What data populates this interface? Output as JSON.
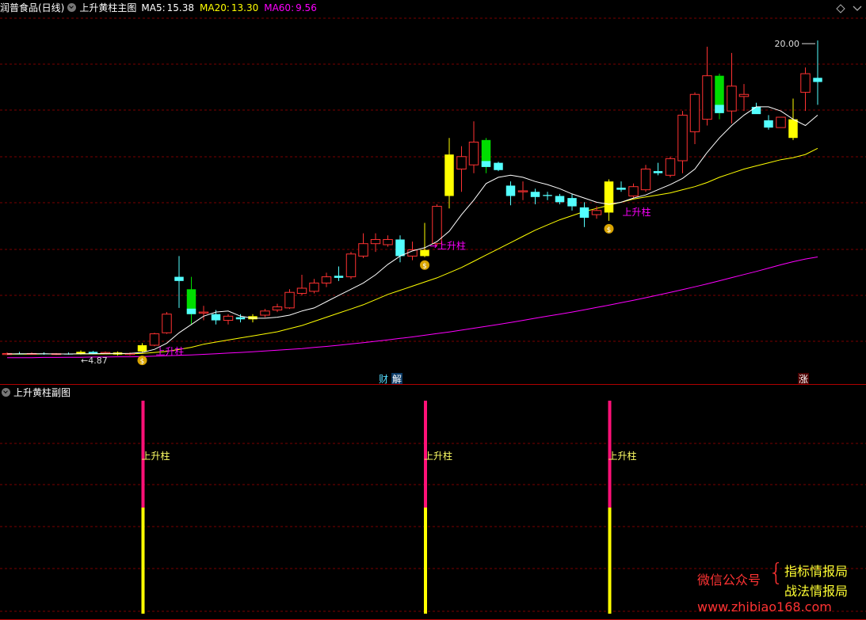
{
  "main_header": {
    "stock_name": "润普食品(日线)",
    "indicator_name": "上升黄柱主图",
    "ma5_label": "MA5:",
    "ma5_value": "15.38",
    "ma20_label": "MA20:",
    "ma20_value": "13.30",
    "ma60_label": "MA60:",
    "ma60_value": "9.56"
  },
  "sub_header": {
    "indicator_name": "上升黄柱副图"
  },
  "colors": {
    "up_candle": "#ff3232",
    "down_candle": "#54ffff",
    "yellow_bar": "#ffff00",
    "green_bar": "#00dd00",
    "ma5": "#ffffff",
    "ma20": "#ffff00",
    "ma60": "#ff00ff",
    "grid": "#7a0000",
    "signal_text": "#ff00ff",
    "sub_top": "#ff1177",
    "watermark_red": "#ff3333",
    "watermark_yellow": "#ffff33"
  },
  "markers": {
    "max_label": "20.00",
    "min_label": "4.87",
    "signal_label": "上升柱",
    "signal_label_arrow": "→上升柱",
    "money_glyph": "$",
    "badge_cai": "财",
    "badge_jie": "解",
    "badge_zhang": "涨"
  },
  "watermark": {
    "wechat": "微信公众号",
    "name1": "指标情报局",
    "name2": "战法情报局",
    "site": "www.zhibiao168.com"
  },
  "chart_data": [
    {
      "type": "candlestick",
      "title": "上升黄柱主图",
      "ylim": [
        4.0,
        21.0
      ],
      "grid": true,
      "candle_colors": [
        "red=up",
        "cyan=down",
        "yellow=上升柱 signal",
        "green=highlighted"
      ],
      "candles": [
        {
          "o": 4.85,
          "h": 4.95,
          "l": 4.82,
          "c": 4.9,
          "t": "up"
        },
        {
          "o": 4.9,
          "h": 4.98,
          "l": 4.86,
          "c": 4.88,
          "t": "down"
        },
        {
          "o": 4.88,
          "h": 4.95,
          "l": 4.84,
          "c": 4.9,
          "t": "up"
        },
        {
          "o": 4.9,
          "h": 4.96,
          "l": 4.84,
          "c": 4.86,
          "t": "down"
        },
        {
          "o": 4.86,
          "h": 4.92,
          "l": 4.83,
          "c": 4.89,
          "t": "up"
        },
        {
          "o": 4.89,
          "h": 4.95,
          "l": 4.85,
          "c": 4.87,
          "t": "down"
        },
        {
          "o": 4.87,
          "h": 5.05,
          "l": 4.85,
          "c": 4.98,
          "t": "yellow"
        },
        {
          "o": 4.98,
          "h": 5.02,
          "l": 4.86,
          "c": 4.9,
          "t": "down"
        },
        {
          "o": 4.9,
          "h": 5.0,
          "l": 4.87,
          "c": 4.95,
          "t": "up"
        },
        {
          "o": 4.95,
          "h": 5.0,
          "l": 4.8,
          "c": 4.85,
          "t": "yellow"
        },
        {
          "o": 4.85,
          "h": 4.95,
          "l": 4.8,
          "c": 4.9,
          "t": "up"
        },
        {
          "o": 5.0,
          "h": 5.4,
          "l": 4.95,
          "c": 5.3,
          "t": "yellow"
        },
        {
          "o": 5.3,
          "h": 5.9,
          "l": 5.25,
          "c": 5.85,
          "t": "up"
        },
        {
          "o": 5.9,
          "h": 6.9,
          "l": 5.85,
          "c": 6.8,
          "t": "up"
        },
        {
          "o": 8.6,
          "h": 9.6,
          "l": 7.1,
          "c": 8.4,
          "t": "down"
        },
        {
          "o": 8.0,
          "h": 8.6,
          "l": 6.3,
          "c": 6.8,
          "t": "green"
        },
        {
          "o": 6.9,
          "h": 7.2,
          "l": 6.5,
          "c": 6.85,
          "t": "up"
        },
        {
          "o": 6.8,
          "h": 7.0,
          "l": 6.3,
          "c": 6.5,
          "t": "down"
        },
        {
          "o": 6.5,
          "h": 6.8,
          "l": 6.3,
          "c": 6.7,
          "t": "up"
        },
        {
          "o": 6.65,
          "h": 6.8,
          "l": 6.4,
          "c": 6.55,
          "t": "down"
        },
        {
          "o": 6.55,
          "h": 6.8,
          "l": 6.4,
          "c": 6.7,
          "t": "yellow"
        },
        {
          "o": 6.75,
          "h": 7.05,
          "l": 6.65,
          "c": 6.95,
          "t": "up"
        },
        {
          "o": 7.0,
          "h": 7.3,
          "l": 6.9,
          "c": 7.15,
          "t": "up"
        },
        {
          "o": 7.1,
          "h": 8.0,
          "l": 7.05,
          "c": 7.85,
          "t": "up"
        },
        {
          "o": 7.8,
          "h": 8.7,
          "l": 7.7,
          "c": 8.05,
          "t": "up"
        },
        {
          "o": 7.9,
          "h": 8.5,
          "l": 7.8,
          "c": 8.3,
          "t": "up"
        },
        {
          "o": 8.3,
          "h": 8.8,
          "l": 8.1,
          "c": 8.6,
          "t": "up"
        },
        {
          "o": 8.65,
          "h": 9.1,
          "l": 8.4,
          "c": 8.55,
          "t": "down"
        },
        {
          "o": 8.6,
          "h": 9.8,
          "l": 8.5,
          "c": 9.7,
          "t": "up"
        },
        {
          "o": 9.6,
          "h": 10.7,
          "l": 9.5,
          "c": 10.2,
          "t": "up"
        },
        {
          "o": 10.2,
          "h": 10.7,
          "l": 9.8,
          "c": 10.4,
          "t": "up"
        },
        {
          "o": 10.4,
          "h": 10.6,
          "l": 10.05,
          "c": 10.15,
          "t": "up"
        },
        {
          "o": 10.4,
          "h": 10.6,
          "l": 9.3,
          "c": 9.6,
          "t": "down"
        },
        {
          "o": 9.6,
          "h": 10.3,
          "l": 9.4,
          "c": 9.9,
          "t": "up"
        },
        {
          "o": 9.6,
          "h": 11.2,
          "l": 9.55,
          "c": 9.9,
          "t": "yellow"
        },
        {
          "o": 10.2,
          "h": 12.1,
          "l": 10.1,
          "c": 12.0,
          "t": "up"
        },
        {
          "o": 14.5,
          "h": 15.3,
          "l": 11.9,
          "c": 12.5,
          "t": "yellow"
        },
        {
          "o": 13.8,
          "h": 14.9,
          "l": 12.7,
          "c": 14.4,
          "t": "up"
        },
        {
          "o": 14.0,
          "h": 16.1,
          "l": 13.6,
          "c": 15.1,
          "t": "up"
        },
        {
          "o": 15.2,
          "h": 15.3,
          "l": 13.6,
          "c": 13.9,
          "t": "green"
        },
        {
          "o": 14.1,
          "h": 14.15,
          "l": 13.7,
          "c": 13.75,
          "t": "down"
        },
        {
          "o": 13.0,
          "h": 13.2,
          "l": 12.05,
          "c": 12.5,
          "t": "down"
        },
        {
          "o": 12.7,
          "h": 13.2,
          "l": 12.3,
          "c": 12.75,
          "t": "up"
        },
        {
          "o": 12.7,
          "h": 12.85,
          "l": 12.1,
          "c": 12.45,
          "t": "down"
        },
        {
          "o": 12.55,
          "h": 12.7,
          "l": 12.3,
          "c": 12.5,
          "t": "down"
        },
        {
          "o": 12.5,
          "h": 12.6,
          "l": 12.1,
          "c": 12.2,
          "t": "down"
        },
        {
          "o": 12.4,
          "h": 12.6,
          "l": 11.8,
          "c": 12.0,
          "t": "down"
        },
        {
          "o": 11.95,
          "h": 12.2,
          "l": 11.0,
          "c": 11.45,
          "t": "down"
        },
        {
          "o": 11.6,
          "h": 12.0,
          "l": 11.4,
          "c": 11.8,
          "t": "up"
        },
        {
          "o": 11.7,
          "h": 13.3,
          "l": 11.3,
          "c": 13.2,
          "t": "yellow"
        },
        {
          "o": 12.9,
          "h": 13.2,
          "l": 12.7,
          "c": 12.8,
          "t": "down"
        },
        {
          "o": 12.5,
          "h": 13.1,
          "l": 12.4,
          "c": 12.95,
          "t": "up"
        },
        {
          "o": 12.8,
          "h": 14.0,
          "l": 12.7,
          "c": 13.8,
          "t": "up"
        },
        {
          "o": 13.7,
          "h": 14.1,
          "l": 13.5,
          "c": 13.6,
          "t": "down"
        },
        {
          "o": 13.5,
          "h": 14.4,
          "l": 13.4,
          "c": 14.3,
          "t": "up"
        },
        {
          "o": 14.2,
          "h": 16.6,
          "l": 13.6,
          "c": 16.4,
          "t": "up"
        },
        {
          "o": 15.6,
          "h": 17.5,
          "l": 15.0,
          "c": 17.4,
          "t": "up"
        },
        {
          "o": 16.2,
          "h": 19.7,
          "l": 15.9,
          "c": 18.3,
          "t": "up"
        },
        {
          "o": 18.3,
          "h": 18.4,
          "l": 16.2,
          "c": 16.5,
          "t": "green"
        },
        {
          "o": 16.6,
          "h": 19.4,
          "l": 16.0,
          "c": 17.8,
          "t": "up"
        },
        {
          "o": 17.4,
          "h": 17.9,
          "l": 16.6,
          "c": 17.3,
          "t": "up"
        },
        {
          "o": 16.8,
          "h": 17.0,
          "l": 16.5,
          "c": 16.45,
          "t": "down"
        },
        {
          "o": 16.15,
          "h": 16.4,
          "l": 15.7,
          "c": 15.8,
          "t": "down"
        },
        {
          "o": 15.8,
          "h": 16.3,
          "l": 15.9,
          "c": 16.3,
          "t": "up"
        },
        {
          "o": 15.3,
          "h": 17.2,
          "l": 15.2,
          "c": 16.2,
          "t": "yellow"
        },
        {
          "o": 17.5,
          "h": 18.7,
          "l": 16.6,
          "c": 18.4,
          "t": "up"
        },
        {
          "o": 18.2,
          "h": 20.0,
          "l": 16.9,
          "c": 18.0,
          "t": "down"
        }
      ],
      "ma": {
        "ma5": [
          4.88,
          4.89,
          4.89,
          4.89,
          4.88,
          4.88,
          4.89,
          4.89,
          4.9,
          4.9,
          4.91,
          4.95,
          5.1,
          5.4,
          5.9,
          6.3,
          6.7,
          6.9,
          6.95,
          6.7,
          6.6,
          6.6,
          6.65,
          6.75,
          6.95,
          7.1,
          7.4,
          7.7,
          8.0,
          8.3,
          8.7,
          9.2,
          9.6,
          9.85,
          10.0,
          10.3,
          10.8,
          11.6,
          12.3,
          13.1,
          13.4,
          13.5,
          13.4,
          13.2,
          13.05,
          12.85,
          12.6,
          12.4,
          12.2,
          12.1,
          12.2,
          12.4,
          12.55,
          12.8,
          13.05,
          13.35,
          13.8,
          14.6,
          15.3,
          15.9,
          16.4,
          16.8,
          16.8,
          16.6,
          16.2,
          15.9,
          16.4
        ],
        "ma20": [
          4.87,
          4.87,
          4.87,
          4.88,
          4.88,
          4.88,
          4.88,
          4.88,
          4.88,
          4.89,
          4.89,
          4.9,
          4.95,
          5.0,
          5.1,
          5.2,
          5.35,
          5.45,
          5.55,
          5.65,
          5.75,
          5.85,
          5.95,
          6.1,
          6.25,
          6.45,
          6.65,
          6.85,
          7.05,
          7.25,
          7.5,
          7.75,
          7.95,
          8.15,
          8.35,
          8.55,
          8.8,
          9.05,
          9.35,
          9.65,
          9.95,
          10.25,
          10.55,
          10.85,
          11.1,
          11.35,
          11.55,
          11.75,
          11.9,
          12.05,
          12.2,
          12.35,
          12.45,
          12.55,
          12.65,
          12.8,
          12.95,
          13.15,
          13.4,
          13.6,
          13.8,
          13.95,
          14.1,
          14.25,
          14.35,
          14.5,
          14.8
        ],
        "ma60": [
          4.7,
          4.7,
          4.7,
          4.71,
          4.71,
          4.72,
          4.72,
          4.73,
          4.73,
          4.74,
          4.74,
          4.75,
          4.77,
          4.79,
          4.81,
          4.83,
          4.86,
          4.89,
          4.92,
          4.95,
          4.98,
          5.02,
          5.06,
          5.1,
          5.14,
          5.19,
          5.24,
          5.3,
          5.36,
          5.42,
          5.49,
          5.56,
          5.63,
          5.7,
          5.78,
          5.86,
          5.94,
          6.03,
          6.12,
          6.21,
          6.3,
          6.4,
          6.5,
          6.6,
          6.7,
          6.8,
          6.9,
          7.01,
          7.12,
          7.23,
          7.35,
          7.47,
          7.59,
          7.72,
          7.85,
          7.98,
          8.12,
          8.26,
          8.41,
          8.56,
          8.71,
          8.86,
          9.02,
          9.18,
          9.33,
          9.46,
          9.56
        ]
      },
      "max_price": 20.0,
      "min_price": 4.87
    },
    {
      "type": "bar",
      "title": "上升黄柱副图",
      "signal_indices": [
        11,
        34,
        49
      ],
      "signal_label": "上升柱"
    }
  ]
}
